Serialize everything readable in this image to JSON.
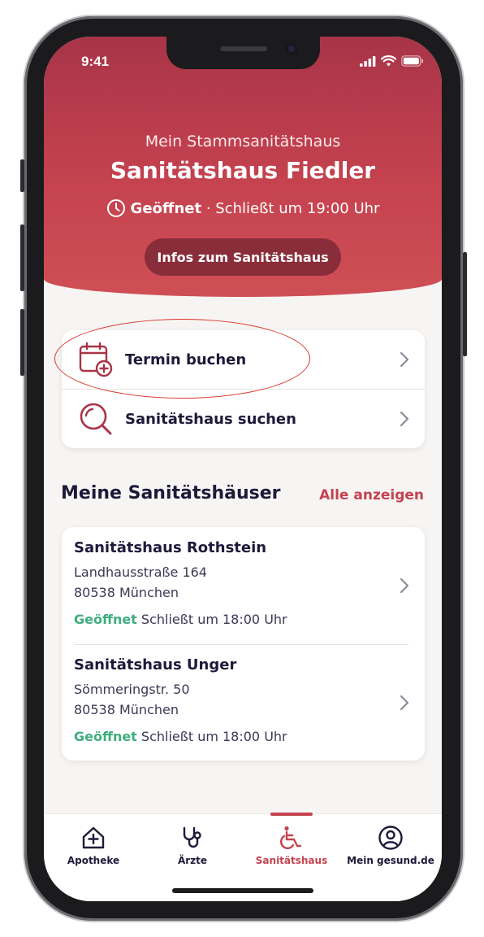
{
  "status_bar": {
    "time": "9:41"
  },
  "header": {
    "subtitle": "Mein Stammsanitätshaus",
    "store_name": "Sanitätshaus Fiedler",
    "open_state": "Geöffnet",
    "closing_info": " · Schließt um 19:00 Uhr",
    "info_button": "Infos zum Sanitätshaus"
  },
  "actions": [
    {
      "label": "Termin buchen",
      "icon": "calendar-add-icon"
    },
    {
      "label": "Sanitätshaus suchen",
      "icon": "search-icon"
    }
  ],
  "my_stores": {
    "title": "Meine Sanitätshäuser",
    "see_all": "Alle anzeigen",
    "items": [
      {
        "name": "Sanitätshaus Rothstein",
        "street": "Landhausstraße 164",
        "city": "80538 München",
        "open": "Geöffnet",
        "closing": "Schließt um 18:00 Uhr"
      },
      {
        "name": "Sanitätshaus Unger",
        "street": "Sömmeringstr. 50",
        "city": "80538 München",
        "open": "Geöffnet",
        "closing": "Schließt um 18:00 Uhr"
      }
    ]
  },
  "tabbar": {
    "tabs": [
      {
        "label": "Apotheke",
        "icon": "pharmacy-home-icon"
      },
      {
        "label": "Ärzte",
        "icon": "stethoscope-icon"
      },
      {
        "label": "Sanitätshaus",
        "icon": "wheelchair-icon",
        "active": true
      },
      {
        "label": "Mein gesund.de",
        "icon": "profile-icon"
      }
    ]
  },
  "colors": {
    "brand": "#c5424f",
    "brand_dark": "#8a2d3a",
    "open_green": "#3fae7f",
    "ink": "#1d1a3a",
    "annotation": "#d8342a"
  }
}
